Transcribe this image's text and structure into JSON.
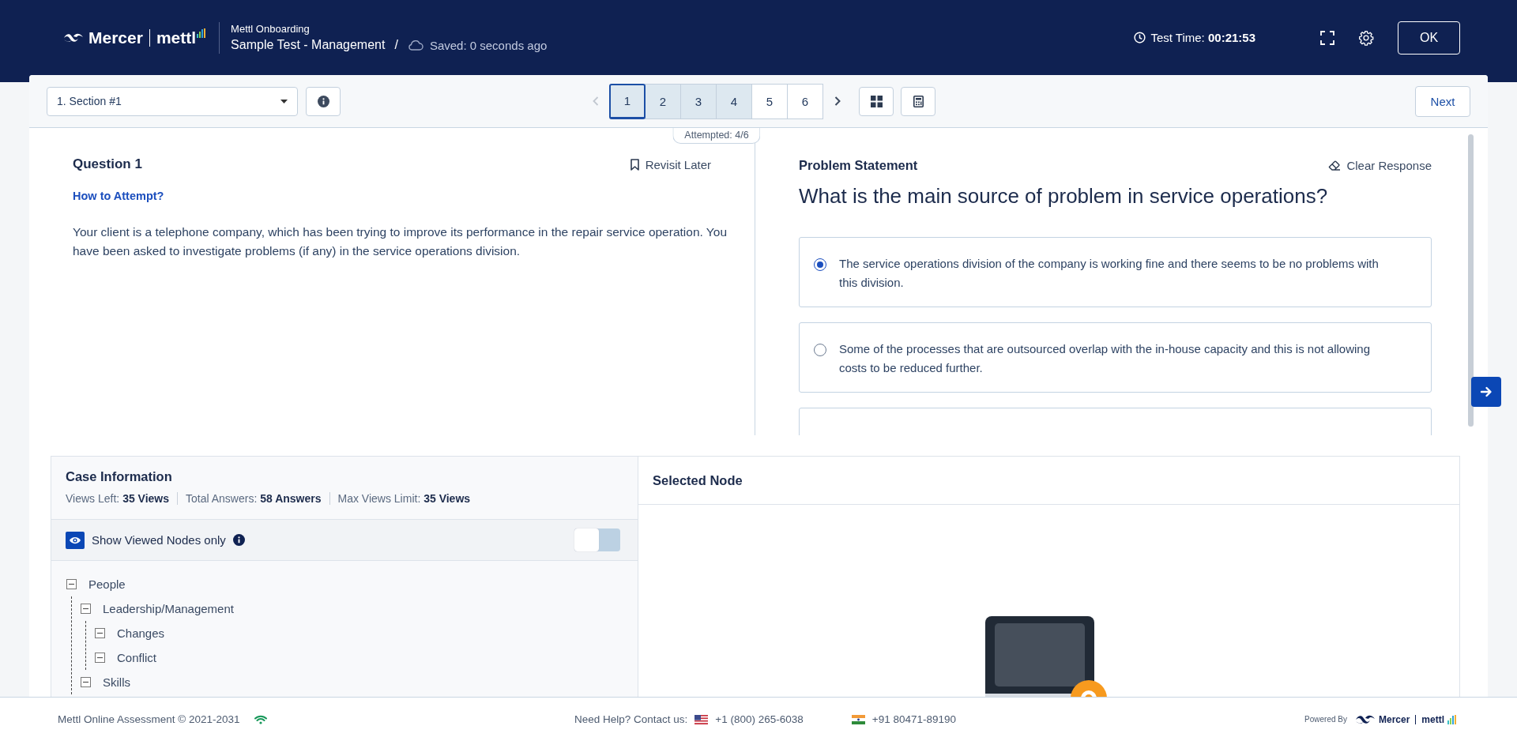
{
  "header": {
    "brand": "Mercer",
    "product": "mettl",
    "subtitle": "Mettl Onboarding",
    "test_name": "Sample Test - Management",
    "separator": "/",
    "save_status": "Saved: 0 seconds ago",
    "timer_label": "Test Time:",
    "timer_value": "00:21:53",
    "ok_button": "OK"
  },
  "toolbar": {
    "section": "1. Section #1",
    "pages": [
      {
        "label": "1",
        "selected": true,
        "attempted": true
      },
      {
        "label": "2",
        "selected": false,
        "attempted": true
      },
      {
        "label": "3",
        "selected": false,
        "attempted": true
      },
      {
        "label": "4",
        "selected": false,
        "attempted": true
      },
      {
        "label": "5",
        "selected": false,
        "attempted": false
      },
      {
        "label": "6",
        "selected": false,
        "attempted": false
      }
    ],
    "attempted": "Attempted: 4/6",
    "next_button": "Next"
  },
  "question": {
    "title": "Question 1",
    "revisit": "Revisit Later",
    "how_to": "How to Attempt?",
    "body": "Your client is a telephone company, which has been trying to improve its performance in the repair service operation. You have been asked to investigate problems (if any) in the service operations division."
  },
  "problem": {
    "title": "Problem Statement",
    "clear": "Clear Response",
    "question": "What is the main source of problem in service operations?",
    "options": [
      {
        "text": "The service operations division of the company is working fine and there seems to be no problems with this division.",
        "selected": true
      },
      {
        "text": "Some of the processes that are outsourced overlap with the in-house capacity and this is not allowing costs to be reduced further.",
        "selected": false
      }
    ]
  },
  "case_info": {
    "title": "Case Information",
    "stats": [
      {
        "label": "Views Left:",
        "value": "35 Views"
      },
      {
        "label": "Total Answers:",
        "value": "58 Answers"
      },
      {
        "label": "Max Views Limit:",
        "value": "35 Views"
      }
    ],
    "filter": {
      "label": "Show Viewed Nodes only",
      "on": false
    },
    "tree": [
      {
        "label": "People",
        "expanded": true,
        "children": [
          {
            "label": "Leadership/Management",
            "expanded": true,
            "children": [
              {
                "label": "Changes",
                "expanded": true
              },
              {
                "label": "Conflict",
                "expanded": true
              }
            ]
          },
          {
            "label": "Skills",
            "expanded": true
          }
        ]
      }
    ]
  },
  "selected_node": {
    "title": "Selected Node"
  },
  "footer": {
    "copyright": "Mettl Online Assessment © 2021-2031",
    "help": "Need Help? Contact us:",
    "phones": [
      "+1 (800) 265-6038",
      "+91 80471-89190"
    ],
    "powered_by": "Powered By",
    "brand": "Mercer",
    "product": "mettl"
  }
}
